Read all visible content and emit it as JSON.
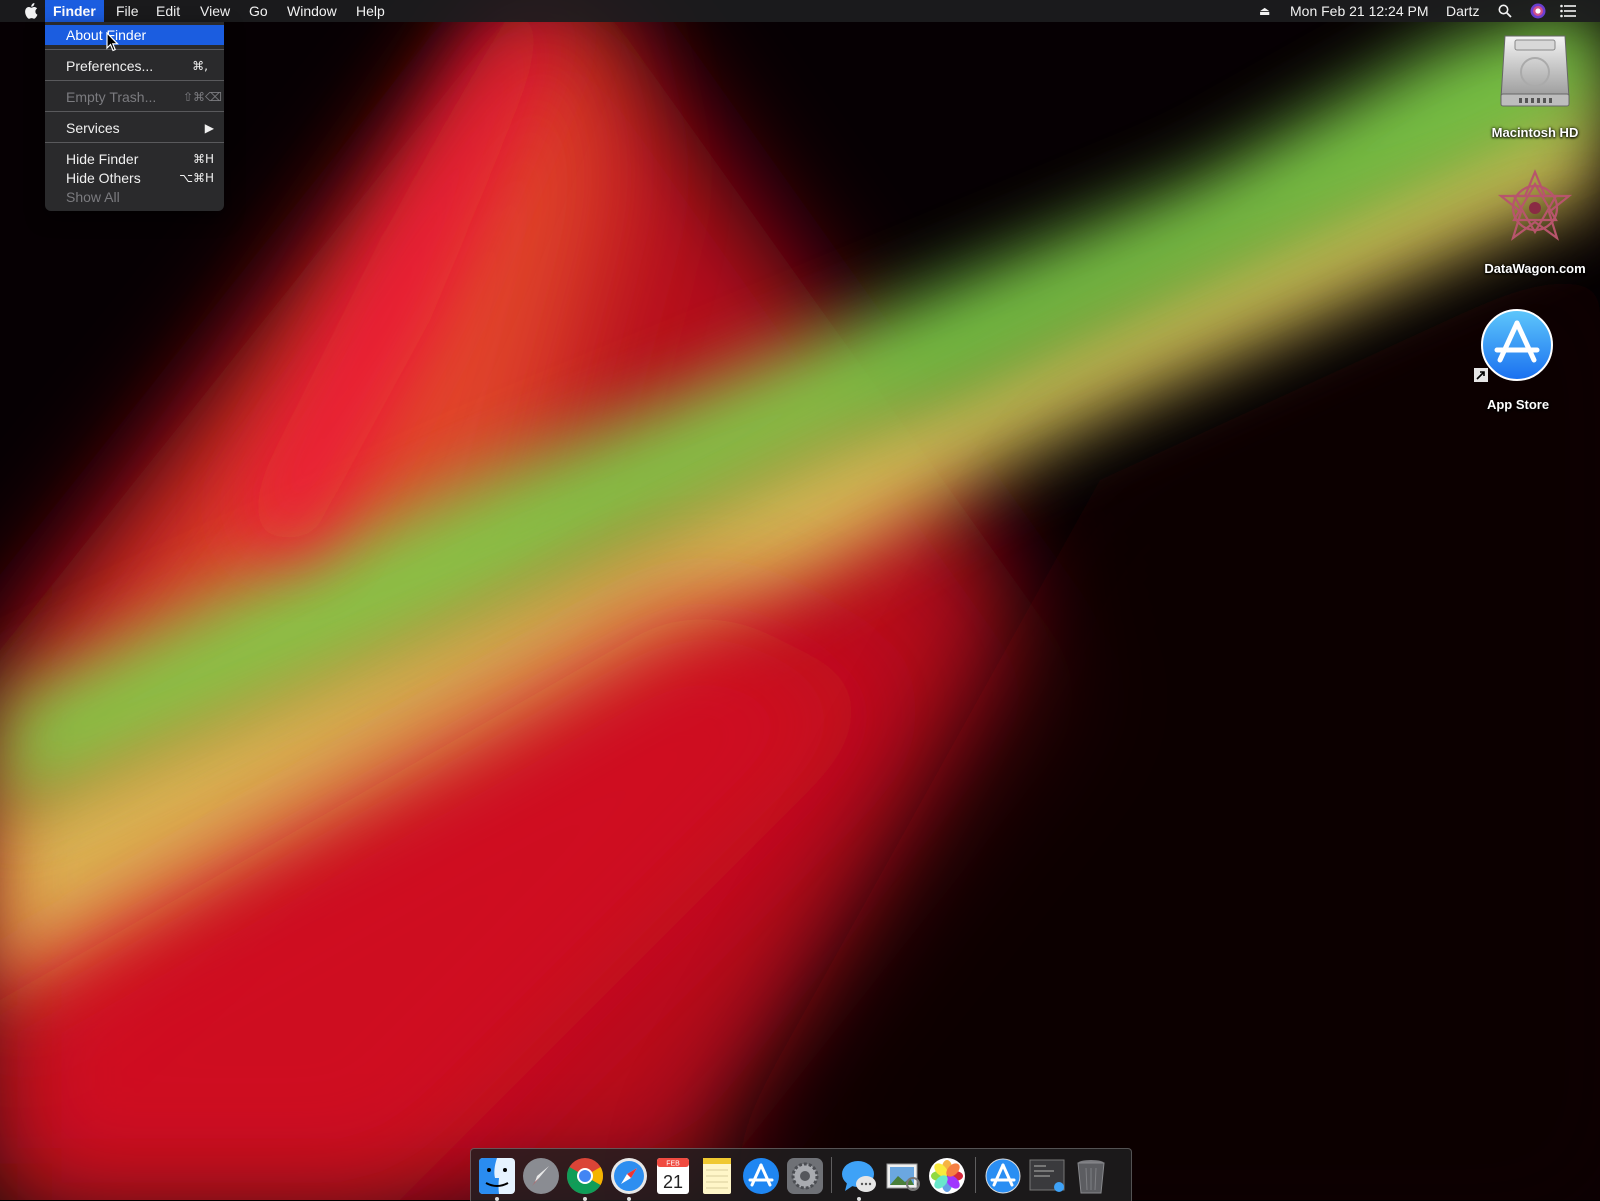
{
  "menubar": {
    "apple_icon": "apple-logo",
    "items": [
      "Finder",
      "File",
      "Edit",
      "View",
      "Go",
      "Window",
      "Help"
    ],
    "active_item": "Finder",
    "status": {
      "eject_icon": "eject-icon",
      "datetime": "Mon Feb 21  12:24 PM",
      "user": "Dartz",
      "spotlight_icon": "search-icon",
      "siri_icon": "siri-icon",
      "notification_icon": "list-icon"
    }
  },
  "finder_menu": {
    "items": [
      {
        "label": "About Finder",
        "shortcut": "",
        "state": "highlighted"
      },
      {
        "label": "Preferences...",
        "shortcut": "⌘,",
        "state": "enabled"
      },
      {
        "label": "Empty Trash...",
        "shortcut": "⇧⌘⌫",
        "state": "disabled"
      },
      {
        "label": "Services",
        "shortcut": "▶",
        "state": "enabled"
      },
      {
        "label": "Hide Finder",
        "shortcut": "⌘H",
        "state": "enabled"
      },
      {
        "label": "Hide Others",
        "shortcut": "⌥⌘H",
        "state": "enabled"
      },
      {
        "label": "Show All",
        "shortcut": "",
        "state": "disabled"
      }
    ]
  },
  "desktop_icons": [
    {
      "label": "Macintosh HD",
      "icon": "hard-drive-icon"
    },
    {
      "label": "DataWagon.com",
      "icon": "datawagon-logo-icon"
    },
    {
      "label": "App Store",
      "icon": "app-store-icon"
    }
  ],
  "dock": {
    "apps": [
      {
        "name": "finder",
        "running": true
      },
      {
        "name": "launchpad",
        "running": false
      },
      {
        "name": "chrome",
        "running": true
      },
      {
        "name": "safari",
        "running": true
      },
      {
        "name": "calendar",
        "running": false,
        "month": "FEB",
        "day": "21"
      },
      {
        "name": "notes",
        "running": false
      },
      {
        "name": "app-store",
        "running": false
      },
      {
        "name": "system-preferences",
        "running": false
      },
      {
        "name": "messages",
        "running": true
      },
      {
        "name": "preview",
        "running": false
      },
      {
        "name": "photos",
        "running": false
      },
      {
        "name": "app-store-download",
        "running": false
      },
      {
        "name": "screenshot-folder",
        "running": false
      },
      {
        "name": "trash",
        "running": false
      }
    ]
  },
  "colors": {
    "menu_highlight": "#1b5de0",
    "wallpaper_red": "#e8102e",
    "wallpaper_yellow": "#e6c85a",
    "wallpaper_green": "#8be05a"
  }
}
